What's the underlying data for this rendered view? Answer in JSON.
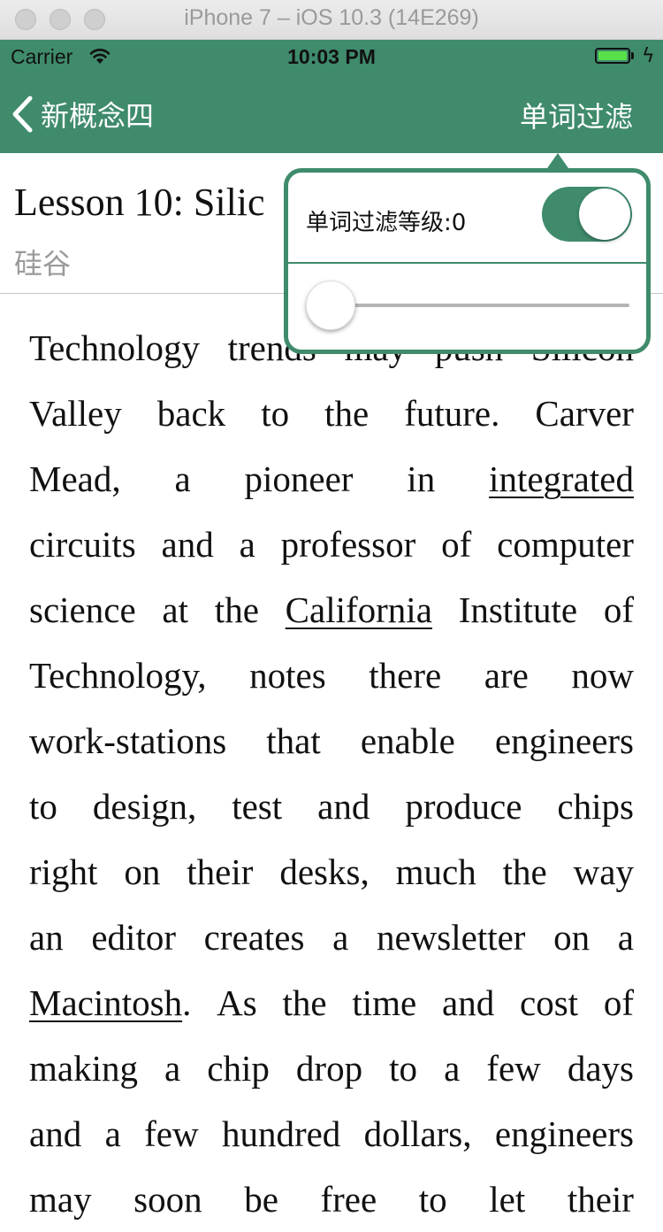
{
  "simulator": {
    "title": "iPhone 7 – iOS 10.3 (14E269)"
  },
  "status_bar": {
    "carrier": "Carrier",
    "time": "10:03 PM",
    "wifi_icon": "wifi-icon",
    "battery_icon": "battery-icon",
    "battery_level": 1.0,
    "charging": true
  },
  "nav": {
    "back_label": "新概念四",
    "back_icon": "chevron-left-icon",
    "filter_label": "单词过滤"
  },
  "lesson": {
    "title": "Lesson 10: Silic",
    "subtitle": "硅谷"
  },
  "popover": {
    "filter_level_label": "单词过滤等级:0",
    "switch_on": true,
    "slider_value": 0
  },
  "article": {
    "lines": [
      [
        {
          "t": "Technology"
        },
        {
          "t": "trends"
        },
        {
          "t": "may"
        },
        {
          "t": "push"
        },
        {
          "t": "Silicon"
        }
      ],
      [
        {
          "t": "Valley"
        },
        {
          "t": "back"
        },
        {
          "t": "to"
        },
        {
          "t": "the"
        },
        {
          "t": "future."
        },
        {
          "t": "Carver"
        }
      ],
      [
        {
          "t": "Mead,"
        },
        {
          "t": "a"
        },
        {
          "t": "pioneer"
        },
        {
          "t": "in"
        },
        {
          "t": "integrated",
          "link": true
        }
      ],
      [
        {
          "t": "circuits"
        },
        {
          "t": "and"
        },
        {
          "t": "a"
        },
        {
          "t": "professor"
        },
        {
          "t": "of"
        },
        {
          "t": "computer"
        }
      ],
      [
        {
          "t": "science"
        },
        {
          "t": "at"
        },
        {
          "t": "the"
        },
        {
          "t": "California",
          "link": true
        },
        {
          "t": "Institute"
        },
        {
          "t": "of"
        }
      ],
      [
        {
          "t": "Technology,"
        },
        {
          "t": "notes"
        },
        {
          "t": "there"
        },
        {
          "t": "are"
        },
        {
          "t": "now"
        }
      ],
      [
        {
          "t": "work-stations"
        },
        {
          "t": "that"
        },
        {
          "t": "enable"
        },
        {
          "t": "engineers"
        }
      ],
      [
        {
          "t": "to"
        },
        {
          "t": "design,"
        },
        {
          "t": "test"
        },
        {
          "t": "and"
        },
        {
          "t": "produce"
        },
        {
          "t": "chips"
        }
      ],
      [
        {
          "t": "right"
        },
        {
          "t": "on"
        },
        {
          "t": "their"
        },
        {
          "t": "desks,"
        },
        {
          "t": "much"
        },
        {
          "t": "the"
        },
        {
          "t": "way"
        }
      ],
      [
        {
          "t": "an"
        },
        {
          "t": "editor"
        },
        {
          "t": "creates"
        },
        {
          "t": "a"
        },
        {
          "t": "newsletter"
        },
        {
          "t": "on"
        },
        {
          "t": "a"
        }
      ],
      [
        {
          "t": "Macintosh",
          "link": true,
          "punct": "."
        },
        {
          "t": "As"
        },
        {
          "t": "the"
        },
        {
          "t": "time"
        },
        {
          "t": "and"
        },
        {
          "t": "cost"
        },
        {
          "t": "of"
        }
      ],
      [
        {
          "t": "making"
        },
        {
          "t": "a"
        },
        {
          "t": "chip"
        },
        {
          "t": "drop"
        },
        {
          "t": "to"
        },
        {
          "t": "a"
        },
        {
          "t": "few"
        },
        {
          "t": "days"
        }
      ],
      [
        {
          "t": "and"
        },
        {
          "t": "a"
        },
        {
          "t": "few"
        },
        {
          "t": "hundred"
        },
        {
          "t": "dollars,"
        },
        {
          "t": "engineers"
        }
      ],
      [
        {
          "t": "may"
        },
        {
          "t": "soon"
        },
        {
          "t": "be"
        },
        {
          "t": "free"
        },
        {
          "t": "to"
        },
        {
          "t": "let"
        },
        {
          "t": "their"
        }
      ]
    ]
  }
}
